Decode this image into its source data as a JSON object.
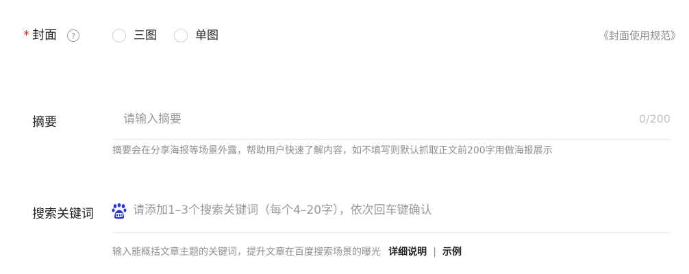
{
  "cover": {
    "required_mark": "*",
    "label": "封面",
    "help_glyph": "?",
    "options": [
      {
        "label": "三图",
        "selected": false
      },
      {
        "label": "单图",
        "selected": false
      }
    ],
    "rules_link": "《封面使用规范》"
  },
  "summary": {
    "label": "摘要",
    "placeholder": "请输入摘要",
    "counter": "0/200",
    "hint": "摘要会在分享海报等场景外露，帮助用户快速了解内容，如不填写则默认抓取正文前200字用做海报展示"
  },
  "keywords": {
    "label": "搜索关键词",
    "icon": "baidu-paw-icon",
    "placeholder": "请添加1–3个搜索关键词（每个4–20字），依次回车键确认",
    "hint": "输入能概括文章主题的关键词，提升文章在百度搜索场景的曝光",
    "detail_link": "详细说明",
    "separator": "|",
    "example_link": "示例"
  },
  "colors": {
    "required": "#e02e24",
    "baidu_blue": "#2932e1"
  }
}
